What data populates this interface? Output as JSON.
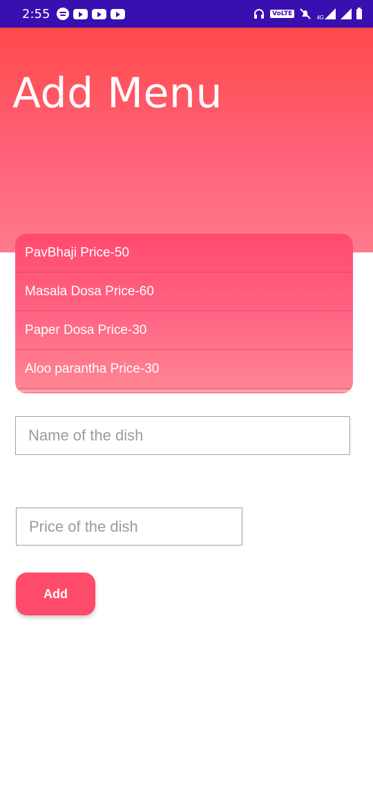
{
  "status_bar": {
    "time": "2:55",
    "volte": "VoLTE",
    "network": "4G",
    "left_icons": [
      "spotify-icon",
      "youtube-icon",
      "youtube-icon",
      "youtube-icon"
    ],
    "right_icons": [
      "headphones-icon",
      "volte-icon",
      "mute-icon",
      "signal-icon",
      "signal-icon",
      "battery-icon"
    ],
    "background_color": "#3a0fb0"
  },
  "header": {
    "title": "Add Menu",
    "gradient_top": "#ff4a4a",
    "gradient_bottom": "#ff7a8c"
  },
  "menu": {
    "items": [
      {
        "label": "PavBhaji Price-50"
      },
      {
        "label": "Masala Dosa Price-60"
      },
      {
        "label": "Paper Dosa Price-30"
      },
      {
        "label": "Aloo parantha Price-30"
      }
    ]
  },
  "form": {
    "name_placeholder": "Name of the dish",
    "name_value": "",
    "price_placeholder": "Price of the dish",
    "price_value": "",
    "add_label": "Add",
    "accent_color": "#ff4b6b"
  }
}
